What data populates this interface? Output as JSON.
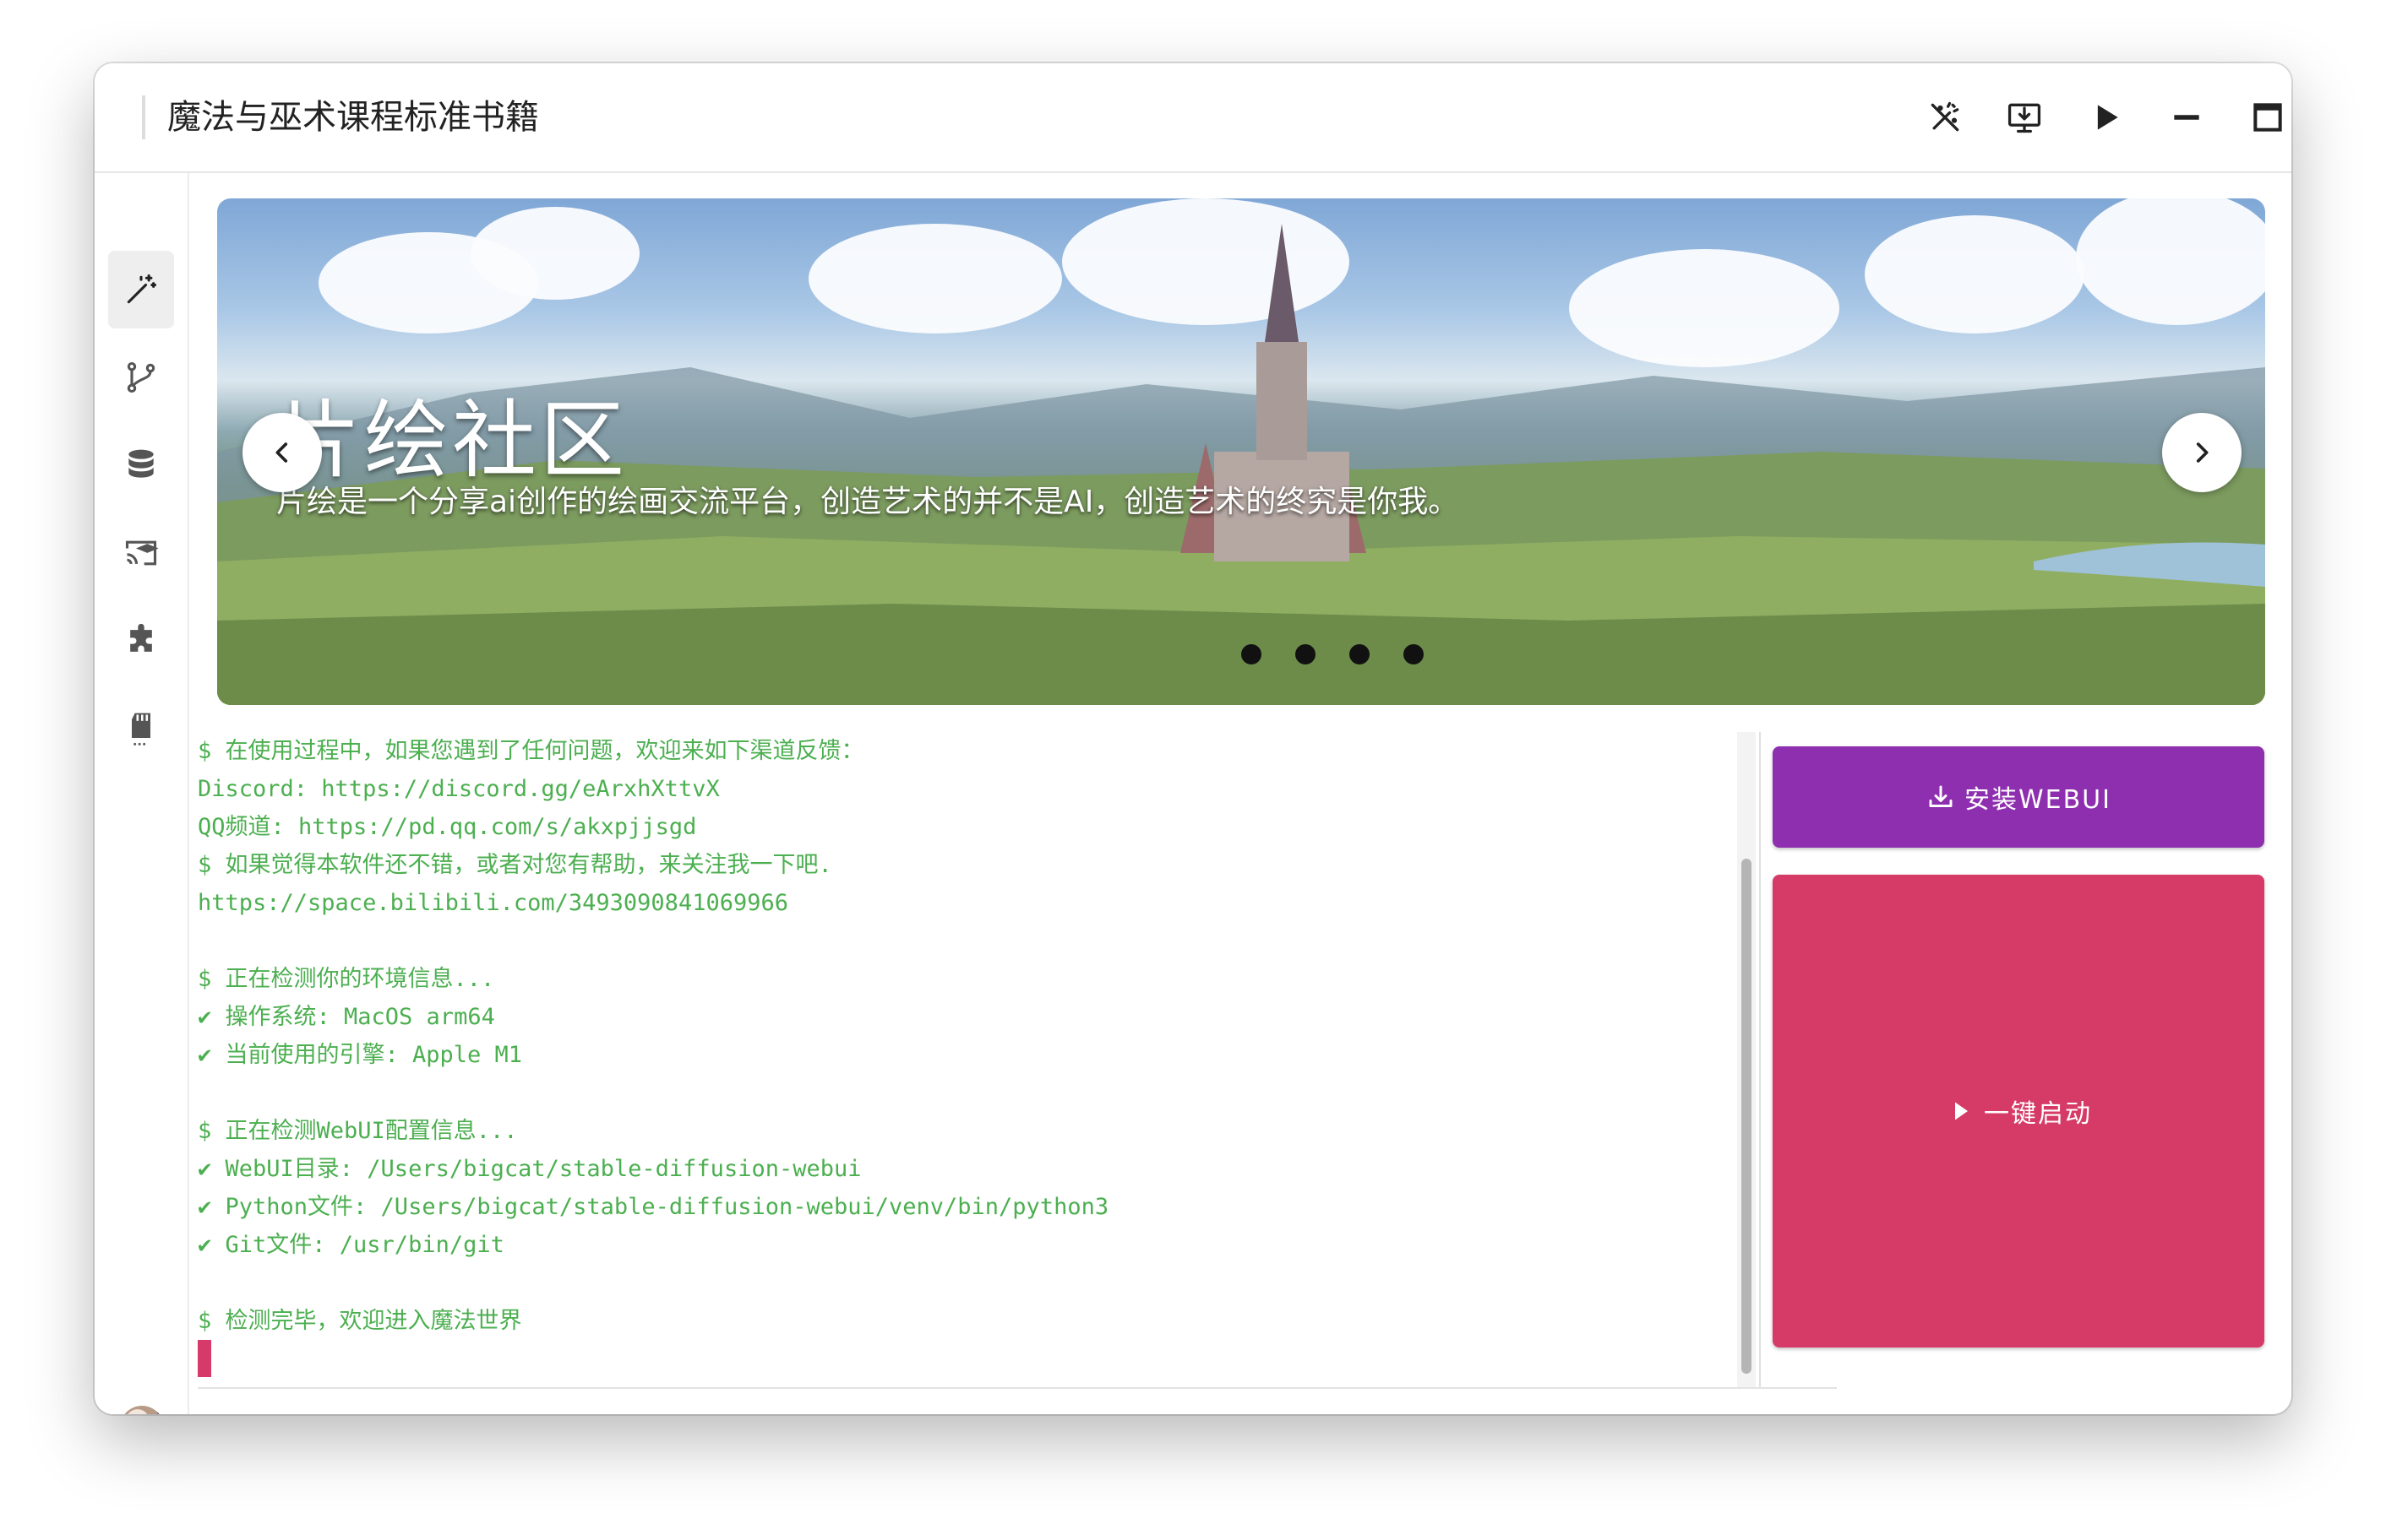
{
  "window": {
    "title": "魔法与巫术课程标准书籍"
  },
  "titlebar": {
    "icons": [
      "magic-off-icon",
      "monitor-download-icon",
      "play-icon",
      "minimize-icon",
      "maximize-icon",
      "close-icon"
    ]
  },
  "sidebar": {
    "items": [
      {
        "icon": "magic-wand-icon",
        "active": true
      },
      {
        "icon": "git-branch-icon",
        "active": false
      },
      {
        "icon": "database-icon",
        "active": false
      },
      {
        "icon": "cast-education-icon",
        "active": false
      },
      {
        "icon": "puzzle-icon",
        "active": false
      },
      {
        "icon": "sd-card-icon",
        "active": false
      }
    ],
    "avatar": "user-avatar"
  },
  "banner": {
    "title": "片绘社区",
    "subtitle": "片绘是一个分享ai创作的绘画交流平台，创造艺术的并不是AI，创造艺术的终究是你我。",
    "slide_count": 4,
    "active_slide": 1
  },
  "terminal": {
    "lines": [
      "$ 在使用过程中，如果您遇到了任何问题，欢迎来如下渠道反馈：",
      "Discord: https://discord.gg/eArxhXttvX",
      "QQ频道: https://pd.qq.com/s/akxpjjsgd",
      "$ 如果觉得本软件还不错，或者对您有帮助，来关注我一下吧.",
      "https://space.bilibili.com/3493090841069966",
      "",
      "$ 正在检测你的环境信息...",
      "✔ 操作系统: MacOS arm64",
      "✔ 当前使用的引擎: Apple M1",
      "",
      "$ 正在检测WebUI配置信息...",
      "✔ WebUI目录: /Users/bigcat/stable-diffusion-webui",
      "✔ Python文件: /Users/bigcat/stable-diffusion-webui/venv/bin/python3",
      "✔ Git文件: /usr/bin/git",
      "",
      "$ 检测完毕，欢迎进入魔法世界"
    ],
    "text_color": "#4caf50",
    "cursor_color": "#d63a6a"
  },
  "actions": {
    "install_label": "安装WEBUI",
    "install_color": "#8e2fb0",
    "launch_label": "一键启动",
    "launch_color": "#d63a66"
  }
}
